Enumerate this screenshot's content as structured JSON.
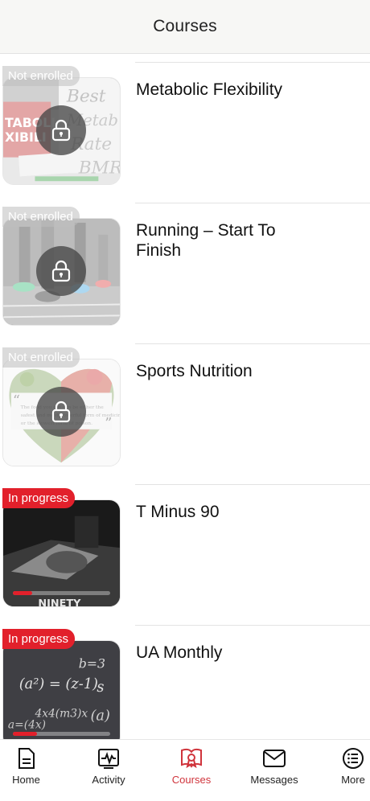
{
  "header": {
    "title": "Courses"
  },
  "courses": [
    {
      "title": "Metabolic Flexibility",
      "status": "Not enrolled",
      "locked": true,
      "art": "metabolic"
    },
    {
      "title": "Running – Start To Finish",
      "status": "Not enrolled",
      "locked": true,
      "art": "running"
    },
    {
      "title": "Sports Nutrition",
      "status": "Not enrolled",
      "locked": true,
      "art": "nutrition"
    },
    {
      "title": "T Minus 90",
      "status": "In progress",
      "locked": false,
      "art": "tminus",
      "progress": 0.2
    },
    {
      "title": "UA Monthly",
      "status": "In progress",
      "locked": false,
      "art": "uamonthly",
      "progress": 0.25
    }
  ],
  "tabbar": {
    "items": [
      {
        "label": "Home",
        "icon": "document-icon"
      },
      {
        "label": "Activity",
        "icon": "activity-icon"
      },
      {
        "label": "Courses",
        "icon": "courses-icon",
        "active": true
      },
      {
        "label": "Messages",
        "icon": "mail-icon"
      },
      {
        "label": "More",
        "icon": "list-icon"
      }
    ]
  },
  "colors": {
    "accent": "#e2202b",
    "active_tab": "#d0343c",
    "header_bg": "#f7f7f5"
  }
}
